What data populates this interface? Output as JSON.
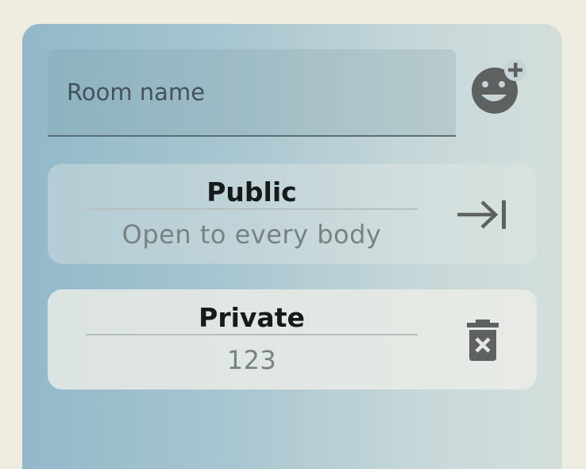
{
  "form": {
    "room_name_placeholder": "Room name",
    "room_name_value": ""
  },
  "rooms": [
    {
      "title": "Public",
      "subtitle": "Open to every body",
      "action_icon": "arrow-right-to-line-icon"
    },
    {
      "title": "Private",
      "subtitle": "123",
      "action_icon": "delete-icon"
    }
  ],
  "colors": {
    "page_background": "#efede1",
    "card_gradient_start": "#92b8ca",
    "card_gradient_end": "#d4dfdc",
    "icon": "#5d6160",
    "title_text": "#161a1a",
    "subtitle_text": "#788283"
  }
}
